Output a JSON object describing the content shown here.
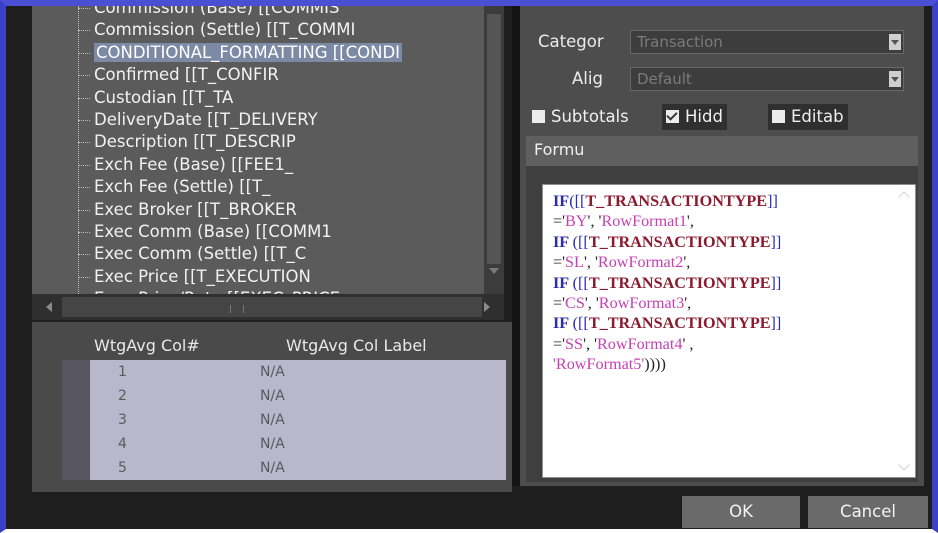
{
  "field_tree": {
    "items": [
      "Commission (Base) [[COMMIS",
      "Commission (Settle) [[T_COMMI",
      "CONDITIONAL_FORMATTING [[CONDI",
      "Confirmed [[T_CONFIR",
      "Custodian [[T_TA",
      "DeliveryDate [[T_DELIVERY",
      "Description [[T_DESCRIP",
      "Exch Fee (Base) [[FEE1_",
      "Exch Fee (Settle) [[T_",
      "Exec Broker [[T_BROKER",
      "Exec Comm (Base) [[COMM1",
      "Exec Comm (Settle) [[T_C",
      "Exec Price [[T_EXECUTION",
      "Exec Price/Rate [[EXEC_PRICE"
    ],
    "selected_index": 2
  },
  "weighted_avg": {
    "col_number_header": "WtgAvg Col#",
    "col_label_header": "WtgAvg Col Label",
    "rows": [
      {
        "num": "1",
        "label": "N/A"
      },
      {
        "num": "2",
        "label": "N/A"
      },
      {
        "num": "3",
        "label": "N/A"
      },
      {
        "num": "4",
        "label": "N/A"
      },
      {
        "num": "5",
        "label": "N/A"
      }
    ]
  },
  "properties": {
    "category_label": "Categor",
    "category_value": "Transaction",
    "align_label": "Alig",
    "align_value": "Default",
    "subtotals_label": "Subtotals",
    "subtotals_checked": false,
    "hidden_label": "Hidd",
    "hidden_checked": true,
    "editable_label": "Editab",
    "editable_checked": false,
    "formula_label": "Formu"
  },
  "formula": {
    "lines": [
      [
        [
          "kw",
          "IF"
        ],
        [
          "br",
          "([["
        ],
        [
          "fld",
          "T_TRANSACTIONTYPE"
        ],
        [
          "br",
          "]]"
        ]
      ],
      [
        [
          "txt",
          "='"
        ],
        [
          "str",
          "BY"
        ],
        [
          "txt",
          "', '"
        ],
        [
          "str",
          "RowFormat1"
        ],
        [
          "txt",
          "',"
        ]
      ],
      [
        [
          "kw",
          "IF "
        ],
        [
          "br",
          "([["
        ],
        [
          "fld",
          "T_TRANSACTIONTYPE"
        ],
        [
          "br",
          "]]"
        ]
      ],
      [
        [
          "txt",
          "='"
        ],
        [
          "str",
          "SL"
        ],
        [
          "txt",
          "', '"
        ],
        [
          "str",
          "RowFormat2"
        ],
        [
          "txt",
          "',"
        ]
      ],
      [
        [
          "kw",
          "IF "
        ],
        [
          "br",
          "([["
        ],
        [
          "fld",
          "T_TRANSACTIONTYPE"
        ],
        [
          "br",
          "]]"
        ]
      ],
      [
        [
          "txt",
          "='"
        ],
        [
          "str",
          "CS"
        ],
        [
          "txt",
          "', '"
        ],
        [
          "str",
          "RowFormat3"
        ],
        [
          "txt",
          "',"
        ]
      ],
      [
        [
          "kw",
          "IF "
        ],
        [
          "br",
          "([["
        ],
        [
          "fld",
          "T_TRANSACTIONTYPE"
        ],
        [
          "br",
          "]]"
        ]
      ],
      [
        [
          "txt",
          "='"
        ],
        [
          "str",
          "SS"
        ],
        [
          "txt",
          "', '"
        ],
        [
          "str",
          "RowFormat4"
        ],
        [
          "txt",
          "' ,"
        ]
      ],
      [
        [
          "str",
          "'RowFormat5'"
        ],
        [
          "txt",
          "))))"
        ]
      ]
    ]
  },
  "buttons": {
    "ok": "OK",
    "cancel": "Cancel"
  }
}
